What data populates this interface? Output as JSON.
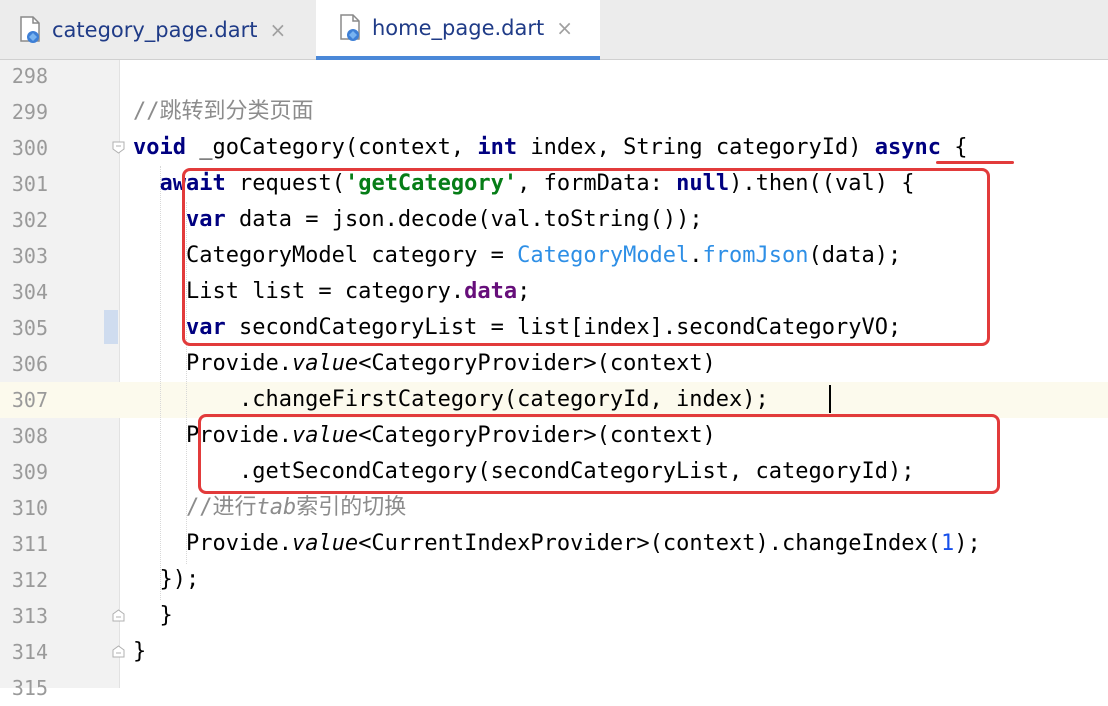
{
  "tabs": [
    {
      "name": "category_page.dart",
      "close": "×",
      "active": false
    },
    {
      "name": "home_page.dart",
      "close": "×",
      "active": true
    }
  ],
  "lines": [
    {
      "n": "298",
      "seg": []
    },
    {
      "n": "299",
      "seg": [
        {
          "t": "//跳转到分类页面",
          "c": "cm"
        }
      ]
    },
    {
      "n": "300",
      "seg": [
        {
          "t": "void",
          "c": "kw"
        },
        {
          "t": " _goCategory(context, "
        },
        {
          "t": "int",
          "c": "kw"
        },
        {
          "t": " index, String categoryId) "
        },
        {
          "t": "async",
          "c": "kw"
        },
        {
          "t": " {"
        }
      ]
    },
    {
      "n": "301",
      "seg": [
        {
          "t": "  "
        },
        {
          "t": "await",
          "c": "kw"
        },
        {
          "t": " request("
        },
        {
          "t": "'getCategory'",
          "c": "str"
        },
        {
          "t": ", formData: "
        },
        {
          "t": "null",
          "c": "kw"
        },
        {
          "t": ").then((val) {"
        }
      ]
    },
    {
      "n": "302",
      "seg": [
        {
          "t": "    "
        },
        {
          "t": "var",
          "c": "kw"
        },
        {
          "t": " data = json.decode(val.toString());"
        }
      ]
    },
    {
      "n": "303",
      "seg": [
        {
          "t": "    CategoryModel category = "
        },
        {
          "t": "CategoryModel",
          "c": "cls"
        },
        {
          "t": "."
        },
        {
          "t": "fromJson",
          "c": "cls"
        },
        {
          "t": "(data);"
        }
      ]
    },
    {
      "n": "304",
      "seg": [
        {
          "t": "    List list = category."
        },
        {
          "t": "data",
          "c": "fld"
        },
        {
          "t": ";"
        }
      ]
    },
    {
      "n": "305",
      "seg": [
        {
          "t": "    "
        },
        {
          "t": "var",
          "c": "kw"
        },
        {
          "t": " secondCategoryList = list[index].secondCategoryVO;"
        }
      ]
    },
    {
      "n": "306",
      "seg": [
        {
          "t": "    Provide."
        },
        {
          "t": "value",
          "c": "it"
        },
        {
          "t": "<CategoryProvider>(context)"
        }
      ]
    },
    {
      "n": "307",
      "seg": [
        {
          "t": "        .changeFirstCategory(categoryId, index);"
        }
      ]
    },
    {
      "n": "308",
      "seg": [
        {
          "t": "    Provide."
        },
        {
          "t": "value",
          "c": "it"
        },
        {
          "t": "<CategoryProvider>(context)"
        }
      ]
    },
    {
      "n": "309",
      "seg": [
        {
          "t": "        .getSecondCategory(secondCategoryList, categoryId);"
        }
      ]
    },
    {
      "n": "310",
      "seg": [
        {
          "t": "    //进行",
          "c": "cm"
        },
        {
          "t": "tab",
          "c": "cm it"
        },
        {
          "t": "索引的切换",
          "c": "cm"
        }
      ]
    },
    {
      "n": "311",
      "seg": [
        {
          "t": "    Provide."
        },
        {
          "t": "value",
          "c": "it"
        },
        {
          "t": "<CurrentIndexProvider>(context).changeIndex("
        },
        {
          "t": "1",
          "c": "num"
        },
        {
          "t": ");"
        }
      ]
    },
    {
      "n": "312",
      "seg": [
        {
          "t": "  });"
        }
      ]
    },
    {
      "n": "313",
      "seg": [
        {
          "t": "  }"
        }
      ]
    },
    {
      "n": "314",
      "seg": [
        {
          "t": "}"
        }
      ]
    },
    {
      "n": "315",
      "seg": []
    }
  ],
  "current_line": "307"
}
